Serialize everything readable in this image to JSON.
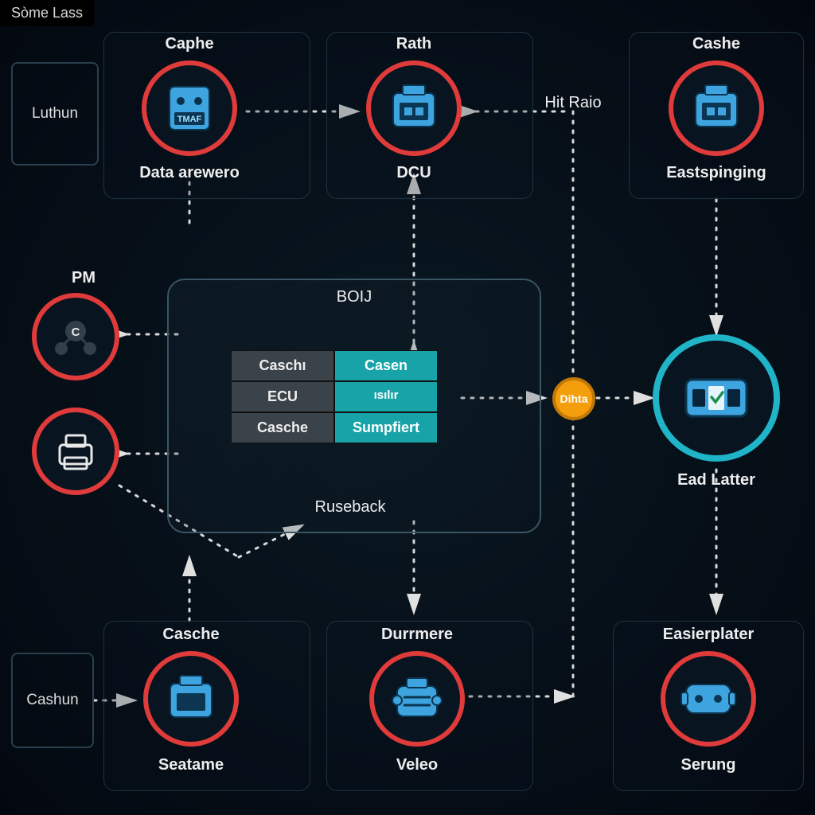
{
  "tab": "Sòme Lass",
  "sidebars": {
    "luthun": "Luthun",
    "cashun": "Cashun"
  },
  "nodes": {
    "caphe": {
      "title": "Caphe",
      "sub": "Data arewero",
      "icon_text": "TMAF"
    },
    "rath": {
      "title": "Rath",
      "sub": "DCU"
    },
    "cashe": {
      "title": "Cashe",
      "sub": "Eastspinging"
    },
    "pm": {
      "title": "PM",
      "badge": "C"
    },
    "printer": {
      "title": ""
    },
    "ead_latter": {
      "title": "Ead Latter"
    },
    "casche_bl": {
      "title": "Casche",
      "sub": "Seatame"
    },
    "durrmere": {
      "title": "Durrmere",
      "sub": "Veleo"
    },
    "easierplater": {
      "title": "Easierplater",
      "sub": "Serung"
    }
  },
  "edge_labels": {
    "hit_raio": "Hit Raio",
    "dilta": "Dihta"
  },
  "center": {
    "title": "BOIJ",
    "bottom": "Ruseback",
    "cells": {
      "r1c1": "Caschı",
      "r1c2": "Casen",
      "r2c1": "ECU",
      "r2c2": "ısılır",
      "r3c1": "Casche",
      "r3c2": "Sumpfiert"
    }
  },
  "colors": {
    "red": "#e03b3b",
    "teal": "#1fb4c8",
    "orange": "#f59e0b",
    "icon_blue": "#3ea4e0"
  }
}
